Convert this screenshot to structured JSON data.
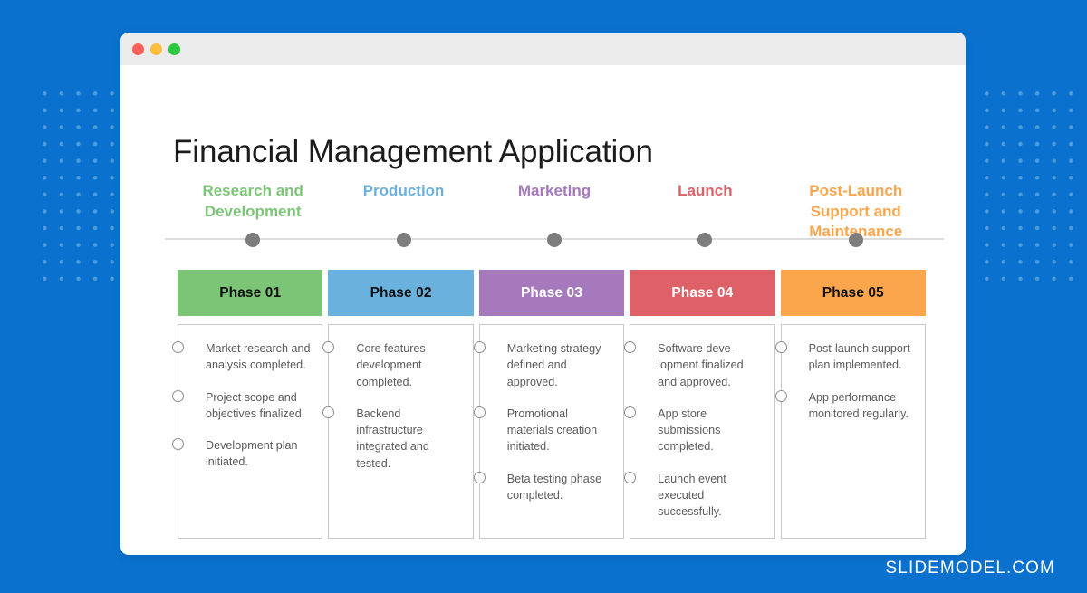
{
  "background": {
    "color": "#0a72ce",
    "dot_color": "#4e9adb"
  },
  "window": {
    "titlebar_color": "#ebebeb",
    "buttons": [
      {
        "name": "close",
        "color": "#ff6058"
      },
      {
        "name": "minimize",
        "color": "#fbbe3f"
      },
      {
        "name": "maximize",
        "color": "#2bc940"
      }
    ]
  },
  "slide": {
    "title": "Financial Management Application",
    "watermark": "SLIDEMODEL.COM",
    "timeline_line_color": "#dcdcdc",
    "timeline_dot_color": "#7d7d7d"
  },
  "columns": [
    {
      "heading": "Research and Development",
      "heading_color": "#7CC576",
      "phase_label": "Phase 01",
      "band_color": "#7CC576",
      "band_text_color": "#111111",
      "bullets": [
        "Market research and analysis completed.",
        "Project scope and objectives finalized.",
        "Development plan initiated."
      ]
    },
    {
      "heading": "Production",
      "heading_color": "#6BB1DE",
      "phase_label": "Phase 02",
      "band_color": "#6BB1DE",
      "band_text_color": "#111111",
      "bullets": [
        "Core features development completed.",
        "Backend infrastructure integrated and tested."
      ]
    },
    {
      "heading": "Marketing",
      "heading_color": "#A579BC",
      "phase_label": "Phase 03",
      "band_color": "#A579BC",
      "band_text_color": "#ffffff",
      "bullets": [
        "Marketing strategy defined and approved.",
        "Promotional materials creation initiated.",
        "Beta testing phase completed."
      ]
    },
    {
      "heading": "Launch",
      "heading_color": "#DD6167",
      "phase_label": "Phase 04",
      "band_color": "#DD6167",
      "band_text_color": "#ffffff",
      "bullets": [
        "Software deve-lopment finalized and approved.",
        "App store submissions completed.",
        "Launch event executed successfully."
      ]
    },
    {
      "heading": "Post-Launch Support and Maintenance",
      "heading_color": "#FBA54C",
      "phase_label": "Phase 05",
      "band_color": "#FBA54C",
      "band_text_color": "#111111",
      "bullets": [
        "Post-launch support plan implemented.",
        "App performance monitored regularly."
      ]
    }
  ]
}
